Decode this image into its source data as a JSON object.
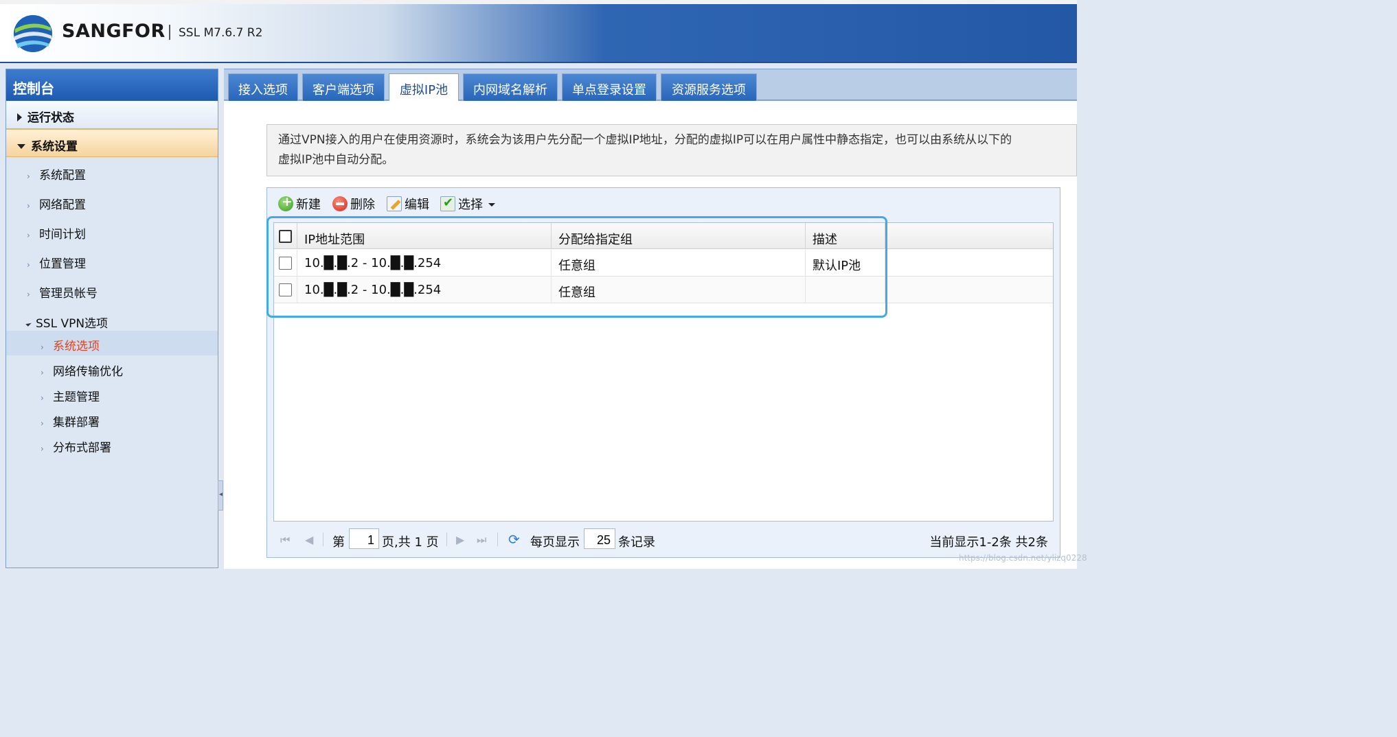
{
  "header": {
    "brand": "SANGFOR",
    "version": "SSL M7.6.7 R2"
  },
  "sidebar": {
    "title": "控制台",
    "sections": [
      {
        "label": "运行状态"
      },
      {
        "label": "系统设置"
      }
    ],
    "items": [
      {
        "label": "系统配置"
      },
      {
        "label": "网络配置"
      },
      {
        "label": "时间计划"
      },
      {
        "label": "位置管理"
      },
      {
        "label": "管理员帐号"
      }
    ],
    "group": {
      "label": "SSL VPN选项"
    },
    "subitems": [
      {
        "label": "系统选项"
      },
      {
        "label": "网络传输优化"
      },
      {
        "label": "主题管理"
      },
      {
        "label": "集群部署"
      },
      {
        "label": "分布式部署"
      }
    ]
  },
  "tabs": [
    {
      "label": "接入选项"
    },
    {
      "label": "客户端选项"
    },
    {
      "label": "虚拟IP池"
    },
    {
      "label": "内网域名解析"
    },
    {
      "label": "单点登录设置"
    },
    {
      "label": "资源服务选项"
    }
  ],
  "description": {
    "line1": "通过VPN接入的用户在使用资源时，系统会为该用户先分配一个虚拟IP地址，分配的虚拟IP可以在用户属性中静态指定，也可以由系统从以下的",
    "line2": "虚拟IP池中自动分配。"
  },
  "toolbar": {
    "new": "新建",
    "delete": "删除",
    "edit": "编辑",
    "select": "选择"
  },
  "table": {
    "columns": [
      "IP地址范围",
      "分配给指定组",
      "描述"
    ],
    "rows": [
      {
        "ip_range": "10.█.█.2 - 10.█.█.254",
        "group": "任意组",
        "description": "默认IP池"
      },
      {
        "ip_range": "10.█.█.2 - 10.█.█.254",
        "group": "任意组",
        "description": ""
      }
    ]
  },
  "pager": {
    "page_label": "第",
    "page_value": "1",
    "page_of": "页,共 1 页",
    "per_page_label": "每页显示",
    "per_page_value": "25",
    "records_label": "条记录",
    "status": "当前显示1-2条 共2条"
  },
  "watermark": "https://blog.csdn.net/ylizq0228",
  "colors": {
    "header_blue": "#2358a6",
    "tab_blue": "#2966ba",
    "highlight": "#43a9e8",
    "active_nav": "#e2431c"
  }
}
